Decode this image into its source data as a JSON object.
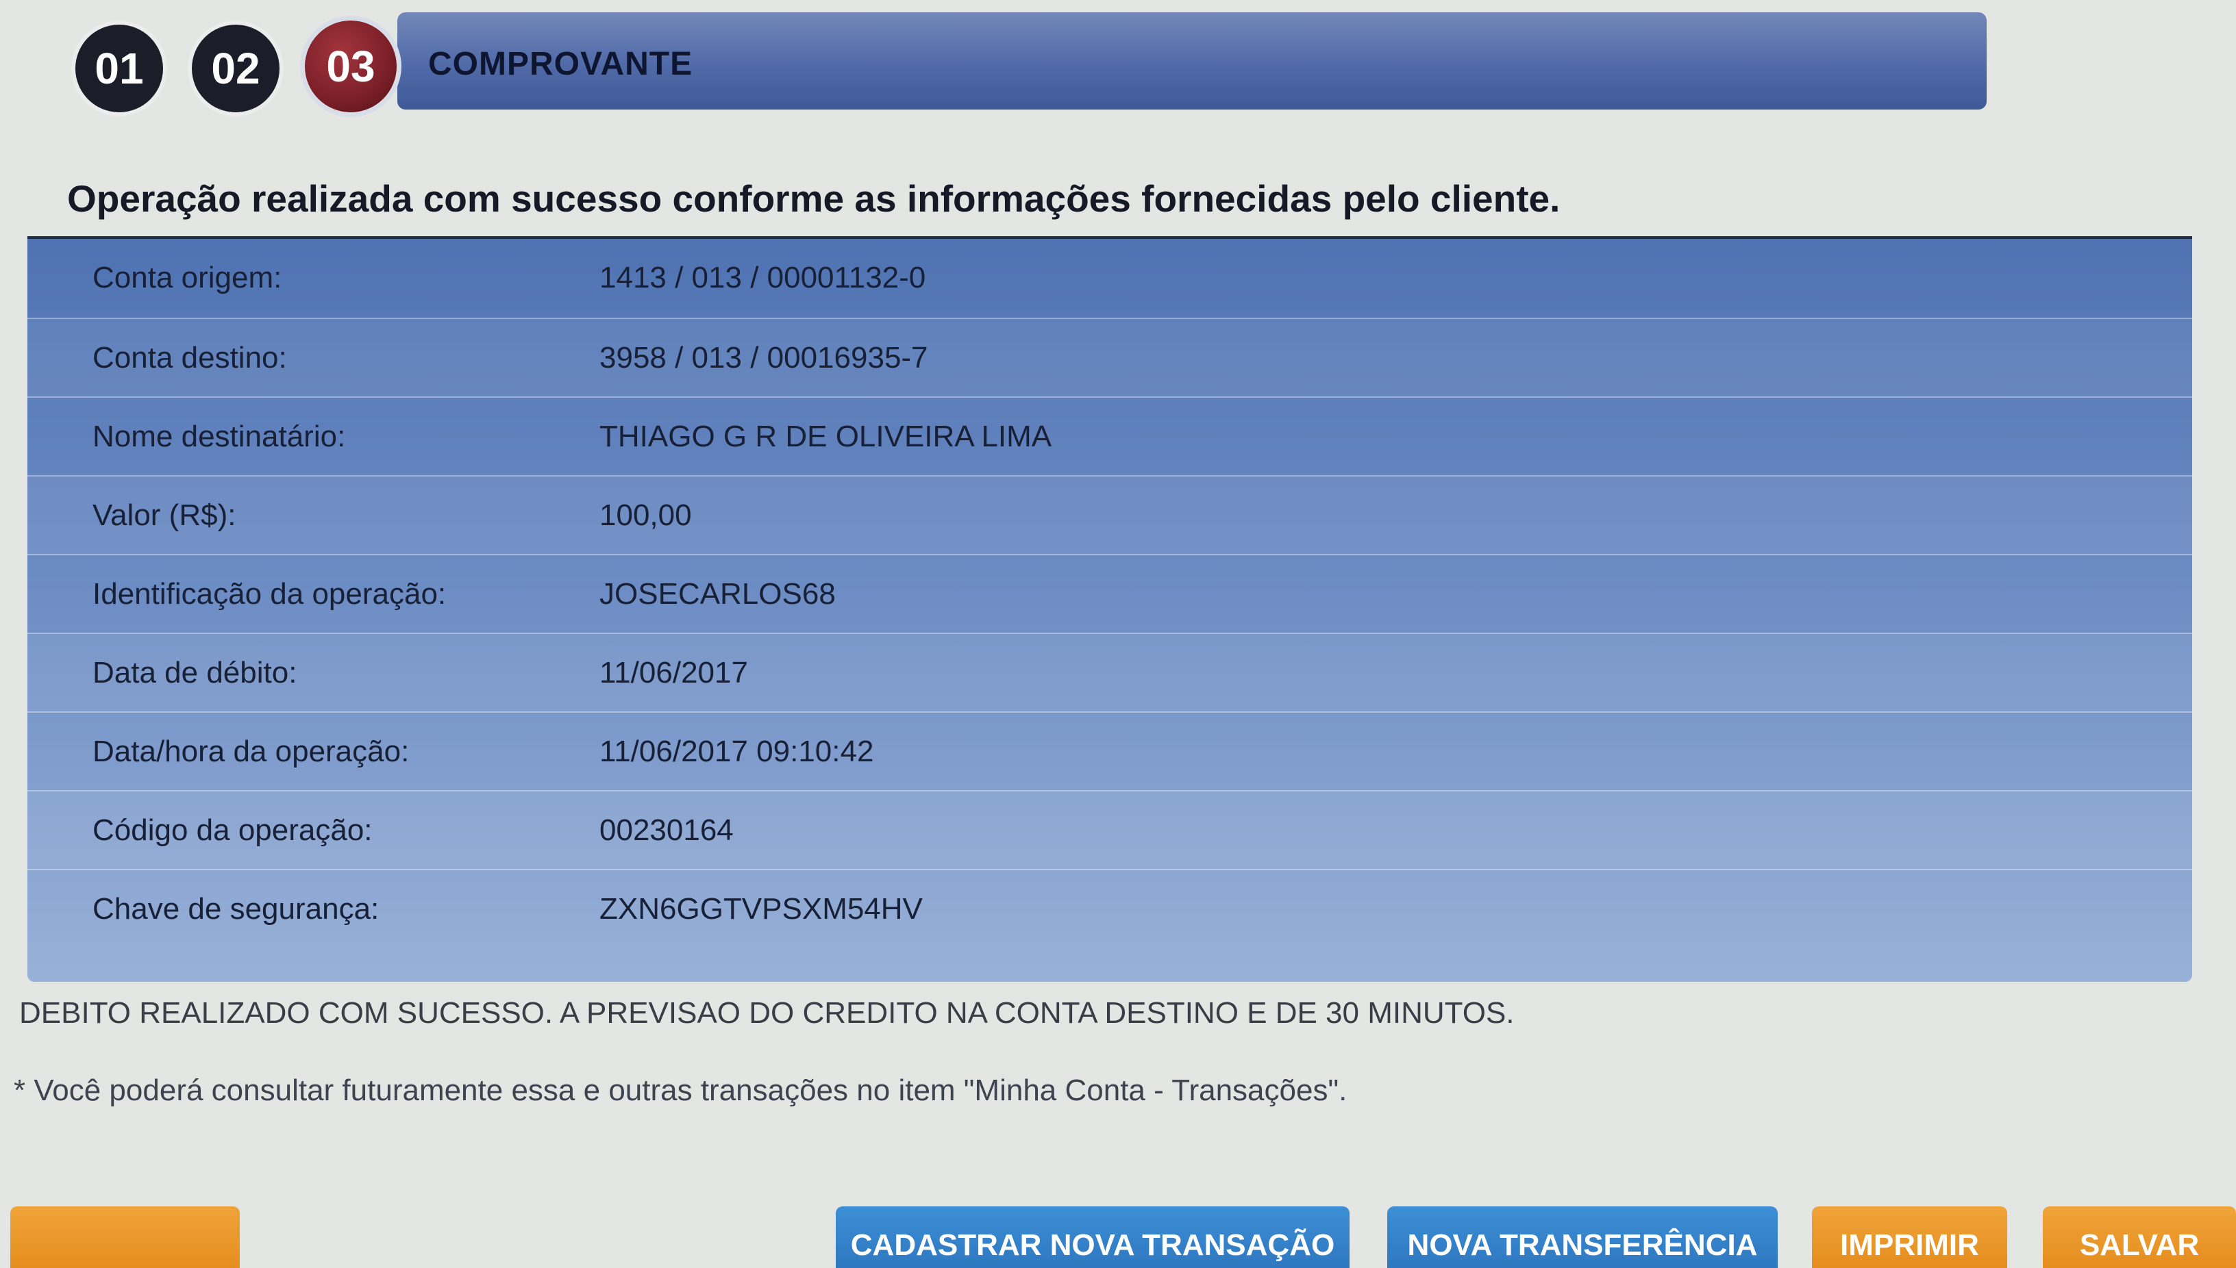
{
  "steps": {
    "items": [
      "01",
      "02",
      "03"
    ],
    "current_label": "COMPROVANTE"
  },
  "heading": "Operação realizada com sucesso conforme as informações fornecidas pelo cliente.",
  "receipt": [
    {
      "label": "Conta origem:",
      "value": "1413 / 013 / 00001132-0"
    },
    {
      "label": "Conta destino:",
      "value": "3958 / 013 / 00016935-7"
    },
    {
      "label": "Nome destinatário:",
      "value": "THIAGO G R DE OLIVEIRA LIMA"
    },
    {
      "label": "Valor (R$):",
      "value": "100,00"
    },
    {
      "label": "Identificação da operação:",
      "value": "JOSECARLOS68"
    },
    {
      "label": "Data de débito:",
      "value": "11/06/2017"
    },
    {
      "label": "Data/hora da operação:",
      "value": "11/06/2017 09:10:42"
    },
    {
      "label": "Código da operação:",
      "value": "00230164"
    },
    {
      "label": "Chave de segurança:",
      "value": "ZXN6GGTVPSXM54HV"
    }
  ],
  "message": "DEBITO REALIZADO COM SUCESSO. A PREVISAO DO CREDITO NA CONTA DESTINO E DE 30 MINUTOS.",
  "note": "* Você poderá consultar futuramente essa e outras transações no item \"Minha Conta - Transações\".",
  "buttons": {
    "back": "",
    "register": "CADASTRAR NOVA TRANSAÇÃO",
    "new_transfer": "NOVA TRANSFERÊNCIA",
    "print": "IMPRIMIR",
    "save": "SALVAR"
  },
  "colors": {
    "step_track": "#506aa8",
    "current_step": "#7a1f28",
    "table_top": "#4f72b2",
    "button_blue": "#2f78c0",
    "button_orange": "#e58d1e"
  }
}
